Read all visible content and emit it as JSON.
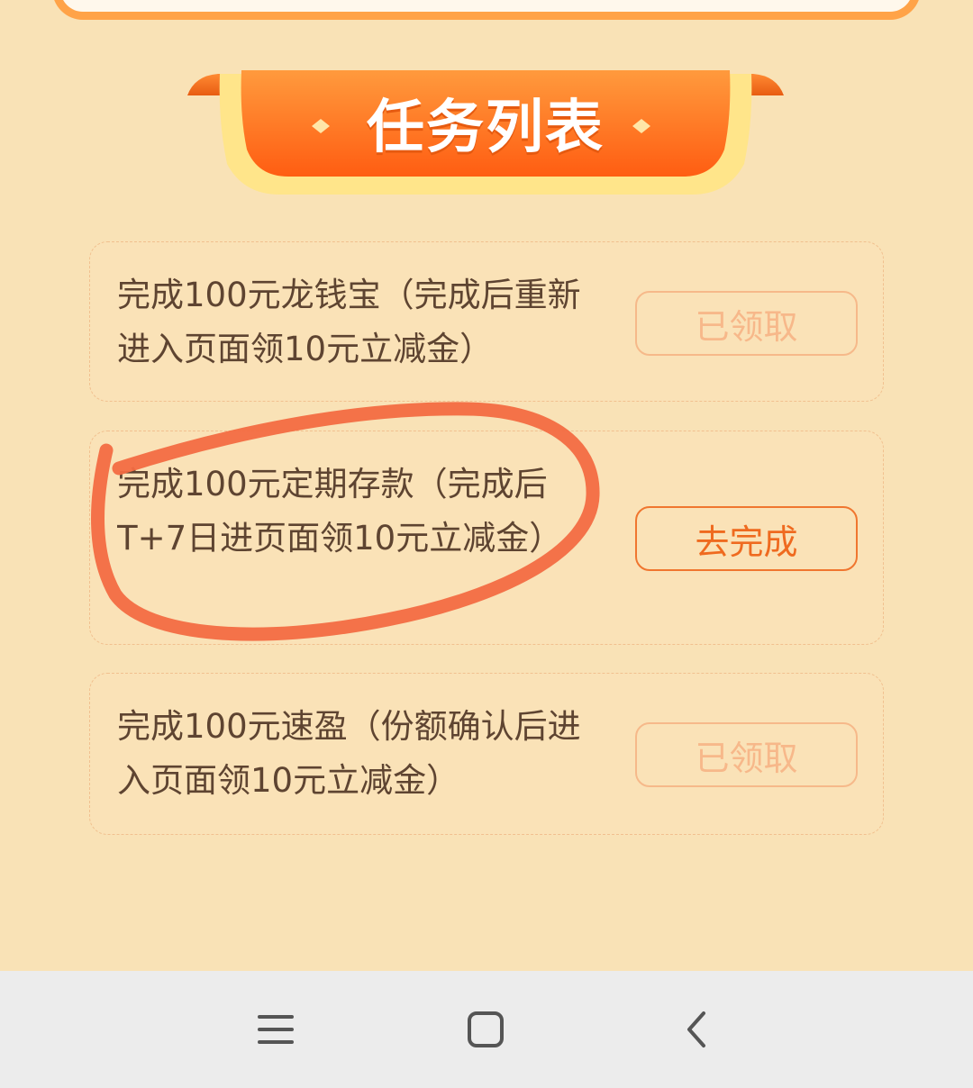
{
  "banner": {
    "title": "任务列表"
  },
  "tasks": [
    {
      "text": "完成100元龙钱宝（完成后重新进入页面领10元立减金）",
      "button_label": "已领取",
      "status": "done"
    },
    {
      "text": "完成100元定期存款（完成后T+7日进页面领10元立减金）",
      "button_label": "去完成",
      "status": "todo"
    },
    {
      "text": "完成100元速盈（份额确认后进入页面领10元立减金）",
      "button_label": "已领取",
      "status": "done"
    }
  ],
  "nav": {
    "icons": [
      "menu-icon",
      "home-icon",
      "back-icon"
    ]
  },
  "colors": {
    "background": "#f9e2b6",
    "accent": "#ff7a1f",
    "done_button": "#f7b88a",
    "todo_button": "#ef6a1f",
    "annotation": "#f36b42"
  }
}
